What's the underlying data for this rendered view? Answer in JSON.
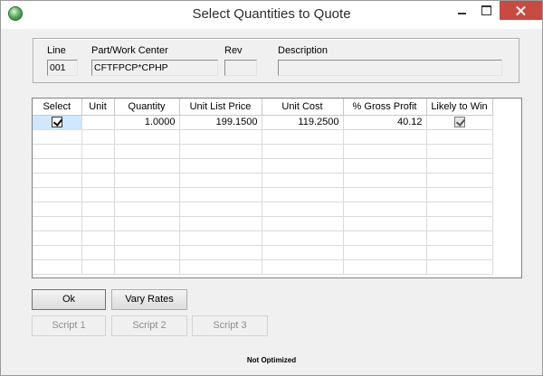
{
  "window": {
    "title": "Select Quantities to Quote"
  },
  "header": {
    "line_label": "Line",
    "line_value": "001",
    "part_label": "Part/Work Center",
    "part_value": "CFTFPCP*CPHP",
    "rev_label": "Rev",
    "rev_value": "",
    "desc_label": "Description",
    "desc_value": ""
  },
  "grid": {
    "columns": [
      "Select",
      "Unit",
      "Quantity",
      "Unit List Price",
      "Unit Cost",
      "% Gross Profit",
      "Likely to Win"
    ],
    "rows": [
      {
        "select": true,
        "unit": "",
        "quantity": "1.0000",
        "unit_list_price": "199.1500",
        "unit_cost": "119.2500",
        "gross_profit": "40.12",
        "likely_to_win": true
      }
    ]
  },
  "buttons": {
    "ok": "Ok",
    "vary_rates": "Vary Rates",
    "script1": "Script 1",
    "script2": "Script 2",
    "script3": "Script 3"
  },
  "status": {
    "text": "Not Optimized"
  },
  "icons": {
    "app": "app-globe-icon",
    "minimize": "minimize-icon",
    "maximize": "maximize-icon",
    "close": "close-icon"
  },
  "colors": {
    "close_button": "#c74b40",
    "selection": "#cde8ff"
  }
}
